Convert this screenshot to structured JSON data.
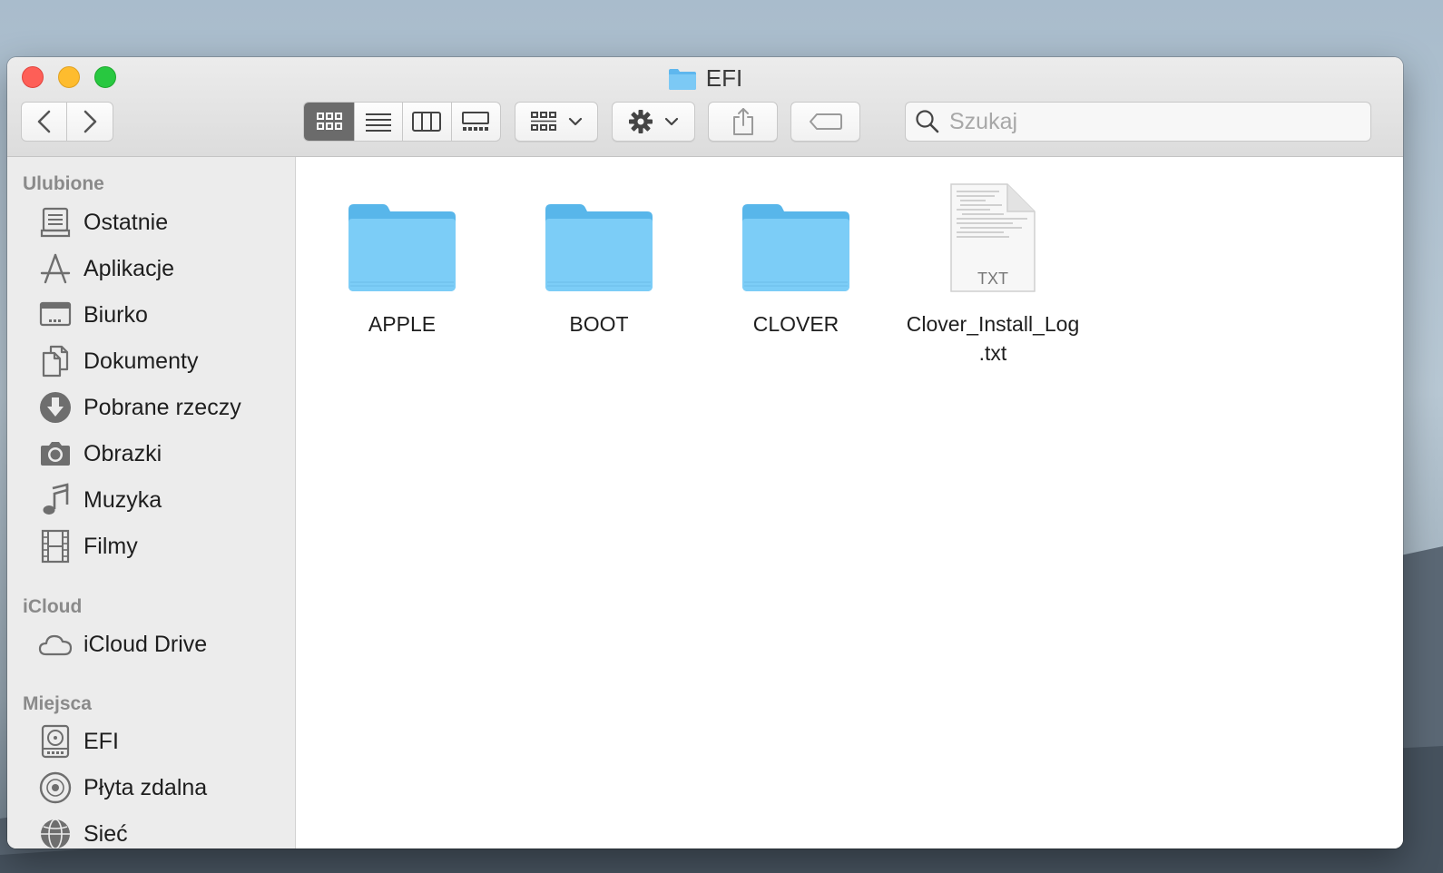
{
  "window": {
    "title": "EFI"
  },
  "toolbar": {
    "search_placeholder": "Szukaj"
  },
  "sidebar": {
    "sections": [
      {
        "header": "Ulubione",
        "items": [
          {
            "label": "Ostatnie",
            "icon": "recents-icon"
          },
          {
            "label": "Aplikacje",
            "icon": "applications-icon"
          },
          {
            "label": "Biurko",
            "icon": "desktop-icon"
          },
          {
            "label": "Dokumenty",
            "icon": "documents-icon"
          },
          {
            "label": "Pobrane rzeczy",
            "icon": "downloads-icon"
          },
          {
            "label": "Obrazki",
            "icon": "camera-icon"
          },
          {
            "label": "Muzyka",
            "icon": "music-note-icon"
          },
          {
            "label": "Filmy",
            "icon": "film-icon"
          }
        ]
      },
      {
        "header": "iCloud",
        "items": [
          {
            "label": "iCloud Drive",
            "icon": "cloud-icon"
          }
        ]
      },
      {
        "header": "Miejsca",
        "items": [
          {
            "label": "EFI",
            "icon": "disk-icon"
          },
          {
            "label": "Płyta zdalna",
            "icon": "optical-disc-icon"
          },
          {
            "label": "Sieć",
            "icon": "network-globe-icon"
          }
        ]
      }
    ]
  },
  "files": [
    {
      "name": "APPLE",
      "type": "folder"
    },
    {
      "name": "BOOT",
      "type": "folder"
    },
    {
      "name": "CLOVER",
      "type": "folder"
    },
    {
      "name_line1": "Clover_Install_Log",
      "name_line2": ".txt",
      "type": "txt",
      "badge": "TXT"
    }
  ],
  "colors": {
    "folder": "#6cc4f2",
    "close": "#fe5f57",
    "minimize": "#febc2e",
    "maximize": "#28c840"
  }
}
